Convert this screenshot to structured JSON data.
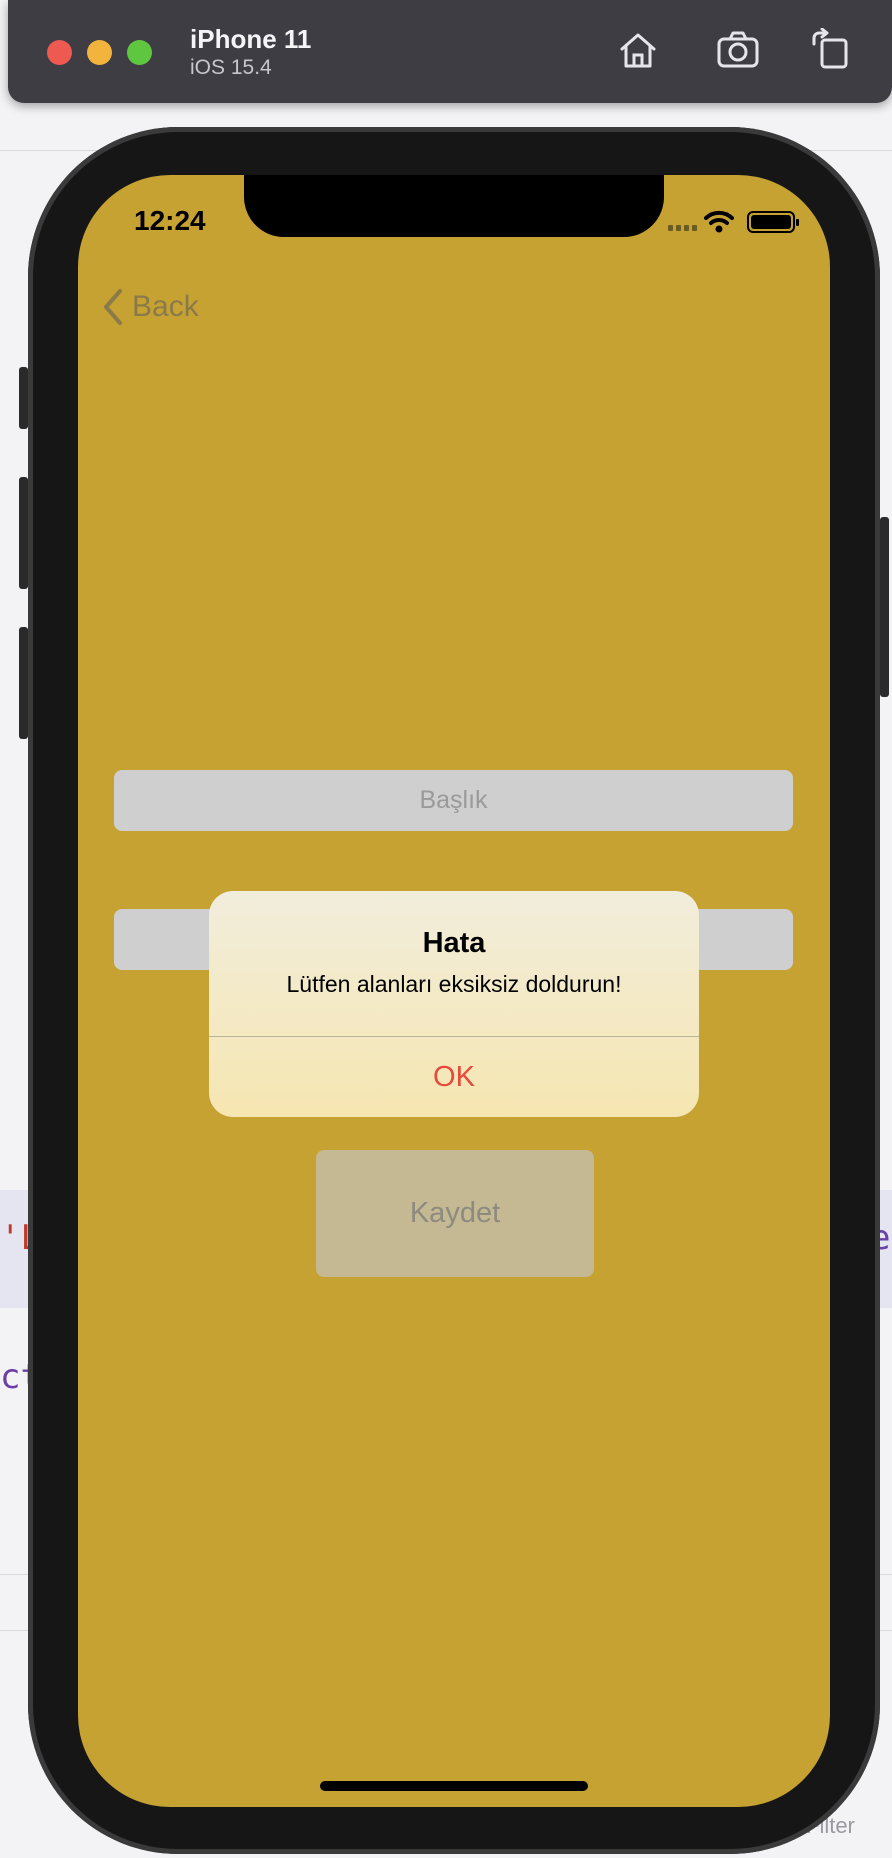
{
  "simulator": {
    "device_name": "iPhone 11",
    "os_version": "iOS 15.4",
    "toolbar_icons": [
      "home-icon",
      "screenshot-icon",
      "rotate-icon"
    ]
  },
  "background": {
    "code_fragment_left": "'L",
    "code_fragment_right": "e",
    "code_fragment_left_2": "ct",
    "filter_label": "Filter"
  },
  "status_bar": {
    "time": "12:24",
    "icons": [
      "cellular-icon",
      "wifi-icon",
      "battery-icon"
    ]
  },
  "nav": {
    "back_label": "Back"
  },
  "form": {
    "title_placeholder": "Başlık",
    "description_placeholder": "",
    "save_label": "Kaydet"
  },
  "alert": {
    "title": "Hata",
    "message": "Lütfen alanları eksiksiz doldurun!",
    "ok_label": "OK"
  },
  "colors": {
    "screen_background": "#c6a233",
    "alert_action": "#e8493c",
    "field_background": "#cfcfcf",
    "button_background": "#c4b992"
  }
}
